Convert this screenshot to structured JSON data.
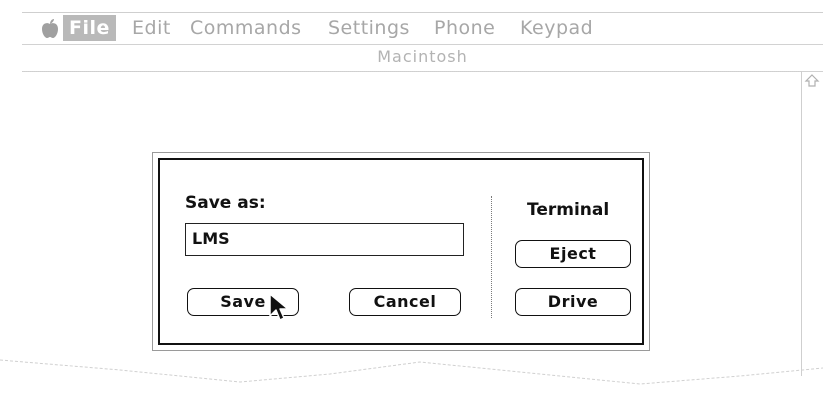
{
  "menubar": {
    "items": [
      {
        "label": "File"
      },
      {
        "label": "Edit"
      },
      {
        "label": "Commands"
      },
      {
        "label": "Settings"
      },
      {
        "label": "Phone"
      },
      {
        "label": "Keypad"
      }
    ]
  },
  "window": {
    "title": "Macintosh"
  },
  "dialog": {
    "save_as_label": "Save as:",
    "filename_value": "LMS",
    "save_label": "Save",
    "cancel_label": "Cancel",
    "volume_label": "Terminal",
    "eject_label": "Eject",
    "drive_label": "Drive"
  },
  "colors": {
    "menu_text": "#a7a7a7",
    "menu_highlight": "#b9b9b9"
  }
}
